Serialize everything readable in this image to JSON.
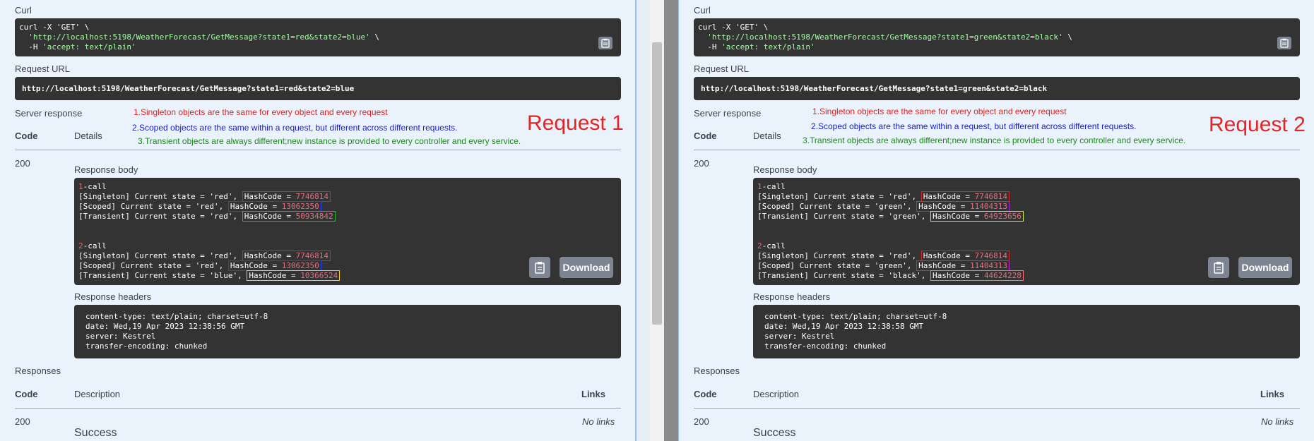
{
  "common": {
    "curl_label": "Curl",
    "request_url_label": "Request URL",
    "server_response_label": "Server response",
    "code_header": "Code",
    "details_header": "Details",
    "status_code": "200",
    "response_body_label": "Response body",
    "response_headers_label": "Response headers",
    "download_label": "Download",
    "responses_label": "Responses",
    "description_header": "Description",
    "links_header": "Links",
    "responses_code": "200",
    "no_links": "No links",
    "success": "Success",
    "notes": {
      "singleton": "1.Singleton objects are the same for every object and every request",
      "scoped": "2.Scoped objects are the same within a request, but different across different requests.",
      "transient": "3.Transient objects are always different;new instance is provided to every controller and every service."
    }
  },
  "panel1": {
    "title": "Request 1",
    "curl": {
      "line1": "curl -X 'GET' \\",
      "line2_url": "'http://localhost:5198/WeatherForecast/GetMessage?state1=red&state2=blue'",
      "line2_suffix": " \\",
      "line3_prefix": "  -H ",
      "line3_value": "'accept: text/plain'"
    },
    "request_url": "http://localhost:5198/WeatherForecast/GetMessage?state1=red&state2=blue",
    "body": {
      "call1_num": "1",
      "call1_label": "-call",
      "call1_singleton_prefix": "[Singleton] Current state = 'red', ",
      "call1_singleton_hash": "7746814",
      "call1_scoped_prefix": "[Scoped] Current state = 'red', ",
      "call1_scoped_hash": "13062350",
      "call1_transient_prefix": "[Transient] Current state = 'red', ",
      "call1_transient_hash": "50934842",
      "call2_num": "2",
      "call2_label": "-call",
      "call2_singleton_prefix": "[Singleton] Current state = 'red', ",
      "call2_singleton_hash": "7746814",
      "call2_scoped_prefix": "[Scoped] Current state = 'red', ",
      "call2_scoped_hash": "13062350",
      "call2_transient_prefix": "[Transient] Current state = 'blue', ",
      "call2_transient_hash": "10366524",
      "hash_label": "HashCode = "
    },
    "headers": {
      "content_type": "content-type: text/plain; charset=utf-8",
      "date": "date: Wed,19 Apr 2023 12:38:56 GMT",
      "server": "server: Kestrel",
      "transfer": "transfer-encoding: chunked"
    }
  },
  "panel2": {
    "title": "Request 2",
    "curl": {
      "line1": "curl -X 'GET' \\",
      "line2_url": "'http://localhost:5198/WeatherForecast/GetMessage?state1=green&state2=black'",
      "line2_suffix": " \\",
      "line3_prefix": "  -H ",
      "line3_value": "'accept: text/plain'"
    },
    "request_url": "http://localhost:5198/WeatherForecast/GetMessage?state1=green&state2=black",
    "body": {
      "call1_num": "1",
      "call1_label": "-call",
      "call1_singleton_prefix": "[Singleton] Current state = 'red', ",
      "call1_singleton_hash": "7746814",
      "call1_scoped_prefix": "[Scoped] Current state = 'green', ",
      "call1_scoped_hash": "11404313",
      "call1_transient_prefix": "[Transient] Current state = 'green', ",
      "call1_transient_hash": "64923656",
      "call2_num": "2",
      "call2_label": "-call",
      "call2_singleton_prefix": "[Singleton] Current state = 'red', ",
      "call2_singleton_hash": "7746814",
      "call2_scoped_prefix": "[Scoped] Current state = 'green', ",
      "call2_scoped_hash": "11404313",
      "call2_transient_prefix": "[Transient] Current state = 'black', ",
      "call2_transient_hash": "44624228",
      "hash_label": "HashCode = "
    },
    "headers": {
      "content_type": "content-type: text/plain; charset=utf-8",
      "date": "date: Wed,19 Apr 2023 12:38:58 GMT",
      "server": "server: Kestrel",
      "transfer": "transfer-encoding: chunked"
    }
  }
}
